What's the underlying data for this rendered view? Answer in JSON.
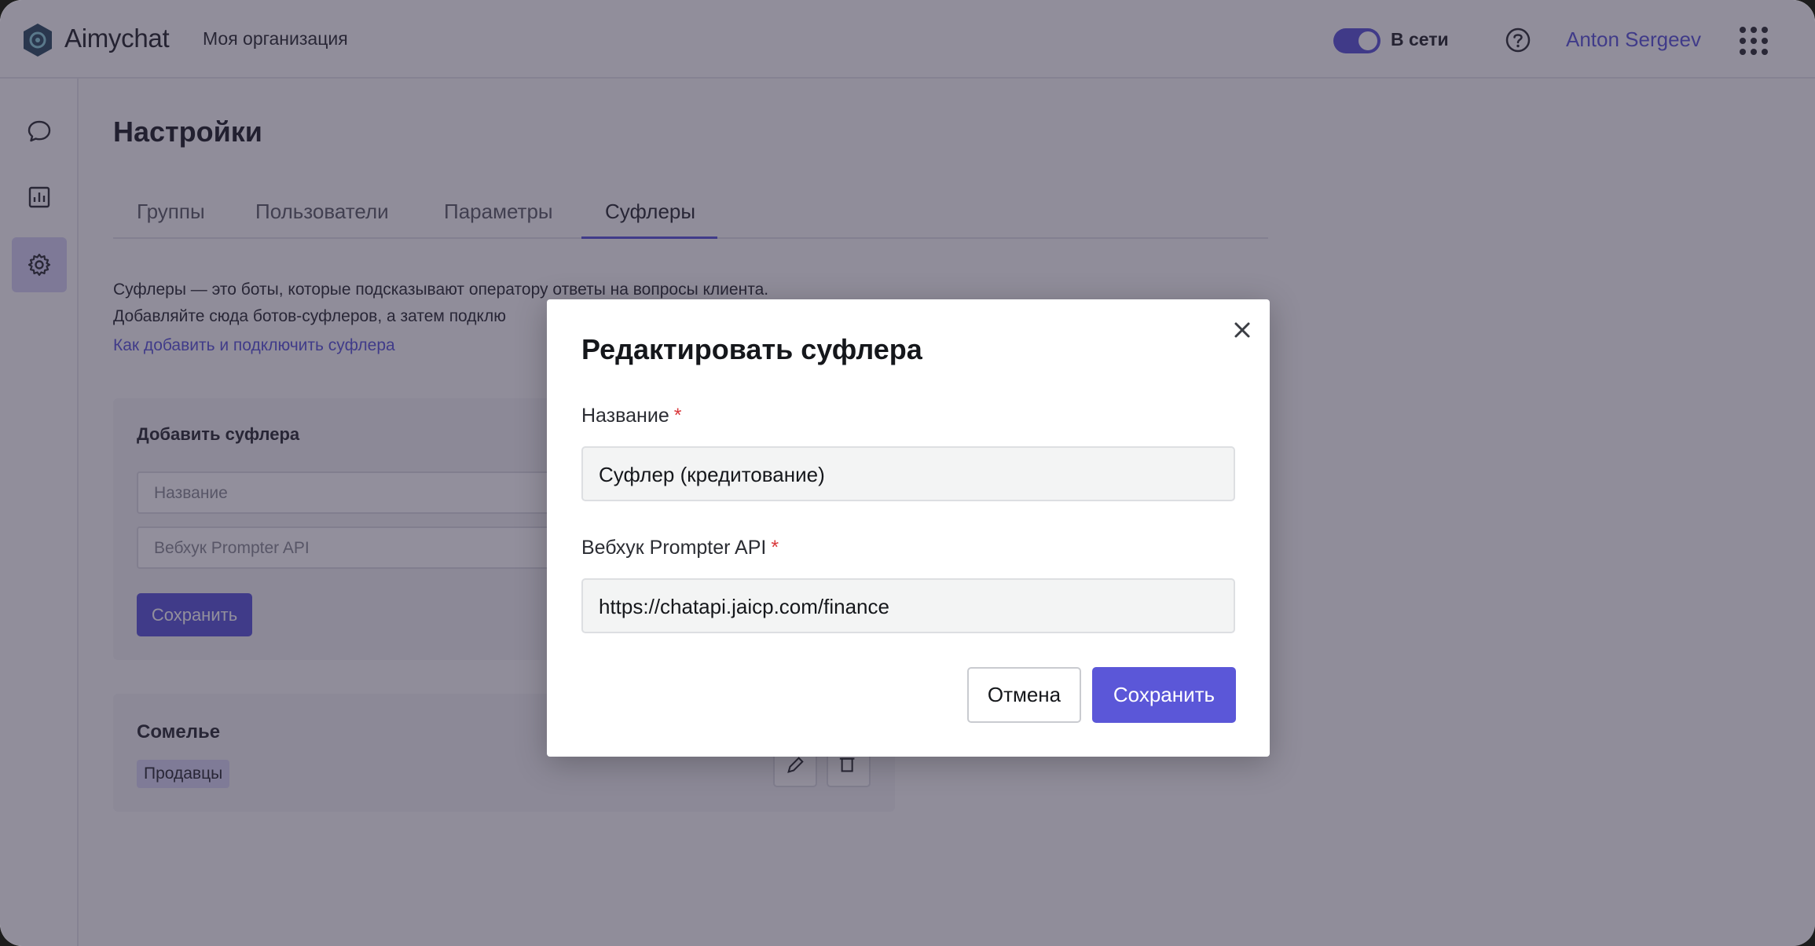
{
  "app": {
    "brand": "Aimychat",
    "organization": "Моя организация",
    "status_label": "В сети",
    "status_online": true,
    "user_name": "Anton Sergeev",
    "accent_color": "#5b57d8"
  },
  "sidebar": {
    "items": [
      {
        "name": "chat-icon",
        "active": false
      },
      {
        "name": "analytics-icon",
        "active": false
      },
      {
        "name": "settings-gear-icon",
        "active": true
      }
    ]
  },
  "page": {
    "title": "Настройки",
    "tabs": [
      {
        "label": "Группы",
        "active": false
      },
      {
        "label": "Пользователи",
        "active": false
      },
      {
        "label": "Параметры",
        "active": false
      },
      {
        "label": "Суфлеры",
        "active": true
      }
    ],
    "description_line1": "Суфлеры — это боты, которые подсказывают оператору ответы на вопросы клиента.",
    "description_line2": "Добавляйте сюда ботов-суфлеров, а затем подклю",
    "help_link": "Как добавить и подключить суфлера"
  },
  "add_form": {
    "title": "Добавить суфлера",
    "name_placeholder": "Название",
    "webhook_placeholder": "Вебхук Prompter API",
    "save_label": "Сохранить"
  },
  "prompter_card": {
    "name": "Сомелье",
    "tag": "Продавцы"
  },
  "modal": {
    "title": "Редактировать суфлера",
    "name_label": "Название",
    "name_value": "Суфлер (кредитование)",
    "webhook_label": "Вебхук Prompter API",
    "webhook_value": "https://chatapi.jaicp.com/finance",
    "required_mark": "*",
    "cancel_label": "Отмена",
    "save_label": "Сохранить"
  }
}
